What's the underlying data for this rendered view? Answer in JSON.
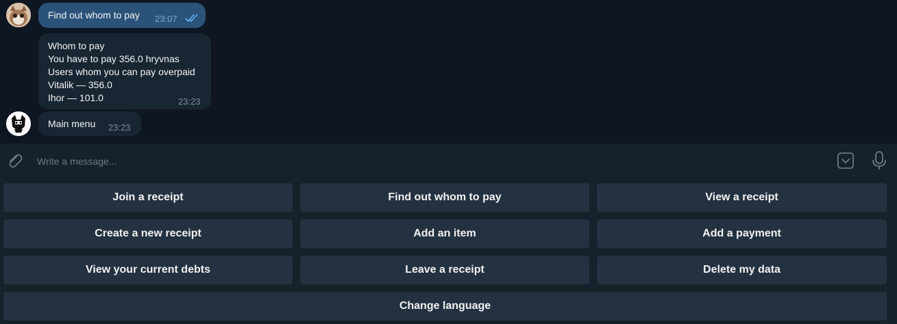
{
  "messages": [
    {
      "direction": "outgoing",
      "text": "Find out whom to pay",
      "time": "23:07",
      "read_status": "double-check-icon"
    },
    {
      "direction": "incoming",
      "lines": [
        "Whom to pay",
        "You have to pay 356.0 hryvnas",
        "Users whom you can pay overpaid",
        "Vitalik — 356.0",
        "Ihor — 101.0"
      ],
      "time": "23:23"
    },
    {
      "direction": "incoming",
      "text": "Main menu",
      "time": "23:23"
    }
  ],
  "input": {
    "placeholder": "Write a message..."
  },
  "keyboard": {
    "rows": [
      [
        "Join a receipt",
        "Find out whom to pay",
        "View a receipt"
      ],
      [
        "Create a new receipt",
        "Add an item",
        "Add a payment"
      ],
      [
        "View your current debts",
        "Leave a receipt",
        "Delete my data"
      ],
      [
        "Change language"
      ]
    ]
  },
  "icons": {
    "attach": "paperclip-icon",
    "keyboard_toggle": "bot-keyboard-icon",
    "voice": "microphone-icon",
    "user_avatar": "user-avatar",
    "bot_avatar": "bot-avatar"
  },
  "colors": {
    "chat_background": "#0e1621",
    "outgoing_bubble": "#2b5278",
    "incoming_bubble": "#182533",
    "keyboard_button": "#243140",
    "panel": "#17212b"
  }
}
